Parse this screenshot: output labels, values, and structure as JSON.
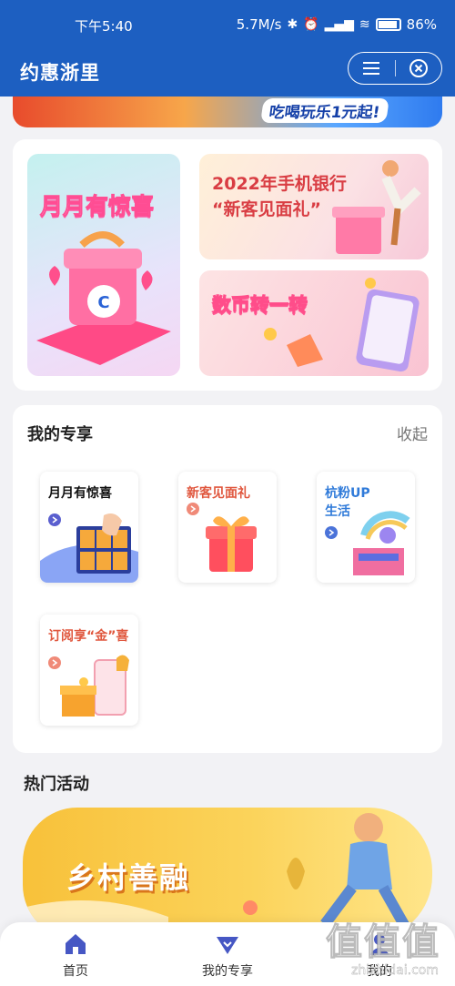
{
  "status_bar": {
    "time": "下午5:40",
    "network_speed": "5.7M/s",
    "battery": "86%"
  },
  "header": {
    "title": "约惠浙里",
    "background": "#1d5fc1"
  },
  "top_strip": {
    "text": "吃喝玩乐1元起!"
  },
  "promo": {
    "big_label": "月月有惊喜",
    "top_line1": "2022年手机银行",
    "top_line2": "“新客见面礼”",
    "bottom_label": "数币转一转"
  },
  "exclusive": {
    "title": "我的专享",
    "collapse_label": "收起",
    "tiles": [
      {
        "label": "月月有惊喜",
        "color": "#111111"
      },
      {
        "label": "新客见面礼",
        "color": "#e0573e"
      },
      {
        "label_line1": "杭粉UP",
        "label_line2": "生活",
        "color": "#2f7ad9"
      },
      {
        "label": "订阅享“金”喜",
        "color": "#e0573e"
      }
    ]
  },
  "hot": {
    "title": "热门活动",
    "banner_label": "乡村善融"
  },
  "tabbar": {
    "items": [
      {
        "label": "首页",
        "icon": "home-icon"
      },
      {
        "label": "我的专享",
        "icon": "heart-diamond-icon"
      },
      {
        "label": "我的",
        "icon": "user-icon"
      }
    ]
  },
  "watermark": {
    "big": "值值值",
    "small": "zhizhidai.com"
  }
}
